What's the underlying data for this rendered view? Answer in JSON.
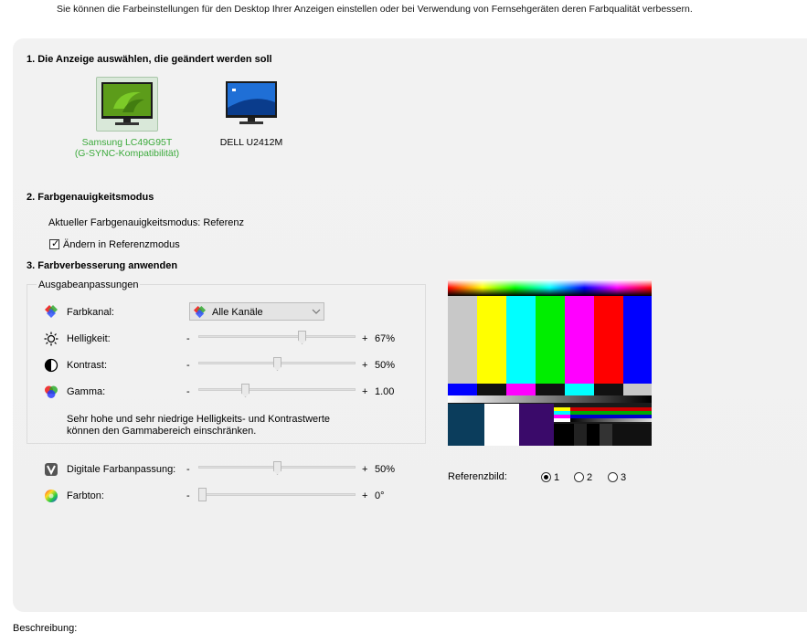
{
  "intro_text": "Sie können die Farbeinstellungen für den Desktop Ihrer Anzeigen einstellen oder bei Verwendung von Fernsehgeräten deren Farbqualität verbessern.",
  "section1": {
    "title": "1. Die Anzeige auswählen, die geändert werden soll",
    "displays": [
      {
        "line1": "Samsung LC49G95T",
        "line2": "(G-SYNC-Kompatibilität)",
        "selected": true
      },
      {
        "line1": "DELL U2412M",
        "line2": "",
        "selected": false
      }
    ]
  },
  "section2": {
    "title": "2. Farbgenauigkeitsmodus",
    "current_mode": "Aktueller Farbgenauigkeitsmodus: Referenz",
    "checkbox_label": "Ändern in Referenzmodus",
    "checkbox_checked": true
  },
  "section3": {
    "title": "3. Farbverbesserung anwenden",
    "group_label": "Ausgabeanpassungen",
    "channel_label": "Farbkanal:",
    "channel_value": "Alle Kanäle",
    "brightness": {
      "label": "Helligkeit:",
      "minus": "-",
      "plus": "+",
      "value": "67%",
      "level": 0.67
    },
    "contrast": {
      "label": "Kontrast:",
      "minus": "-",
      "plus": "+",
      "value": "50%",
      "level": 0.5
    },
    "gamma": {
      "label": "Gamma:",
      "minus": "-",
      "plus": "+",
      "value": "1.00",
      "level": 0.29
    },
    "note_line1": "Sehr hohe und sehr niedrige Helligkeits- und Kontrastwerte",
    "note_line2": "können den Gammabereich einschränken.",
    "digital_vibrance": {
      "label": "Digitale Farbanpassung:",
      "minus": "-",
      "plus": "+",
      "value": "50%",
      "level": 0.5
    },
    "hue": {
      "label": "Farbton:",
      "minus": "-",
      "plus": "+",
      "value": "0°",
      "level": 0.0
    },
    "reference_label": "Referenzbild:",
    "reference_options": [
      "1",
      "2",
      "3"
    ],
    "reference_selected": "1"
  },
  "description_label": "Beschreibung:",
  "colors": {
    "accent_green": "#3caa3c",
    "panel_bg": "#f1f1f1"
  }
}
